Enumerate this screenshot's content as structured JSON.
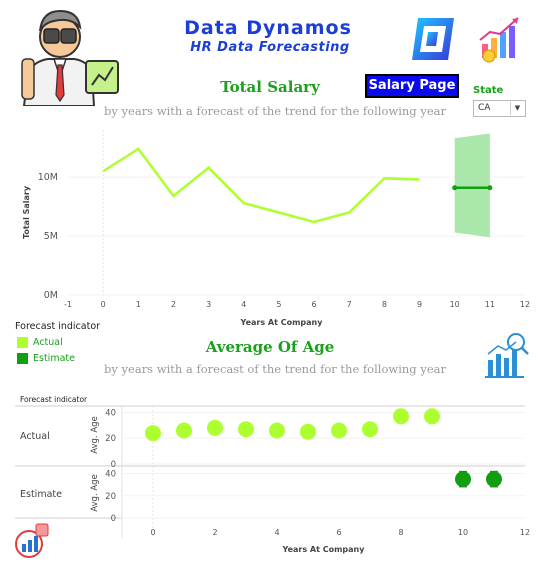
{
  "header": {
    "title": "Data Dynamos",
    "subtitle": "HR Data Forecasting",
    "salary_page_button": "Salary Page",
    "state": {
      "label": "State",
      "value": "CA"
    }
  },
  "colors": {
    "actual": "#adff2f",
    "estimate": "#0f9f0f",
    "band": "#9be39b",
    "title_blue": "#1a3fd6",
    "section_green": "#1aa01a"
  },
  "legend": {
    "title": "Forecast indicator",
    "items": [
      "Actual",
      "Estimate"
    ]
  },
  "salary_section": {
    "title": "Total Salary",
    "subtitle": "by years with a forecast of the trend for the following year"
  },
  "age_section": {
    "title": "Average Of Age",
    "subtitle": "by years with a forecast of the trend for the following year"
  },
  "chart_data": [
    {
      "type": "line",
      "xlabel": "Years At Company",
      "ylabel": "Total Salary",
      "x_ticks": [
        "-1",
        "0",
        "1",
        "2",
        "3",
        "4",
        "5",
        "6",
        "7",
        "8",
        "9",
        "10",
        "11",
        "12"
      ],
      "y_ticks": [
        "0M",
        "5M",
        "10M"
      ],
      "xlim": [
        -1,
        12
      ],
      "ylim": [
        0,
        14
      ],
      "series": [
        {
          "indicator": "Actual",
          "x": [
            0,
            1,
            2,
            3,
            4,
            5,
            6,
            7,
            8,
            9
          ],
          "values": [
            10.5,
            12.4,
            8.4,
            10.8,
            7.8,
            7.0,
            6.2,
            7.0,
            9.9,
            9.8
          ]
        },
        {
          "indicator": "Estimate",
          "x": [
            10,
            11
          ],
          "values": [
            9.1,
            9.1
          ],
          "band_low": [
            5.3,
            4.9
          ],
          "band_high": [
            13.3,
            13.7
          ]
        }
      ]
    },
    {
      "type": "scatter",
      "xlabel": "Years At Company",
      "ylabel": "Avg. Age",
      "row_header": "Forecast indicator",
      "x_ticks": [
        "0",
        "2",
        "4",
        "6",
        "8",
        "10",
        "12"
      ],
      "y_ticks": [
        "0",
        "20",
        "40"
      ],
      "xlim": [
        -1,
        12
      ],
      "ylim": [
        0,
        45
      ],
      "rows": [
        {
          "label": "Actual",
          "x": [
            0,
            1,
            2,
            3,
            4,
            5,
            6,
            7,
            8,
            9
          ],
          "values": [
            24,
            26,
            28,
            27,
            26,
            25,
            26,
            27,
            37,
            37
          ]
        },
        {
          "label": "Estimate",
          "x": [
            10,
            11
          ],
          "values": [
            35,
            35
          ],
          "err_low": [
            28,
            28
          ],
          "err_high": [
            42,
            42
          ]
        }
      ]
    }
  ]
}
